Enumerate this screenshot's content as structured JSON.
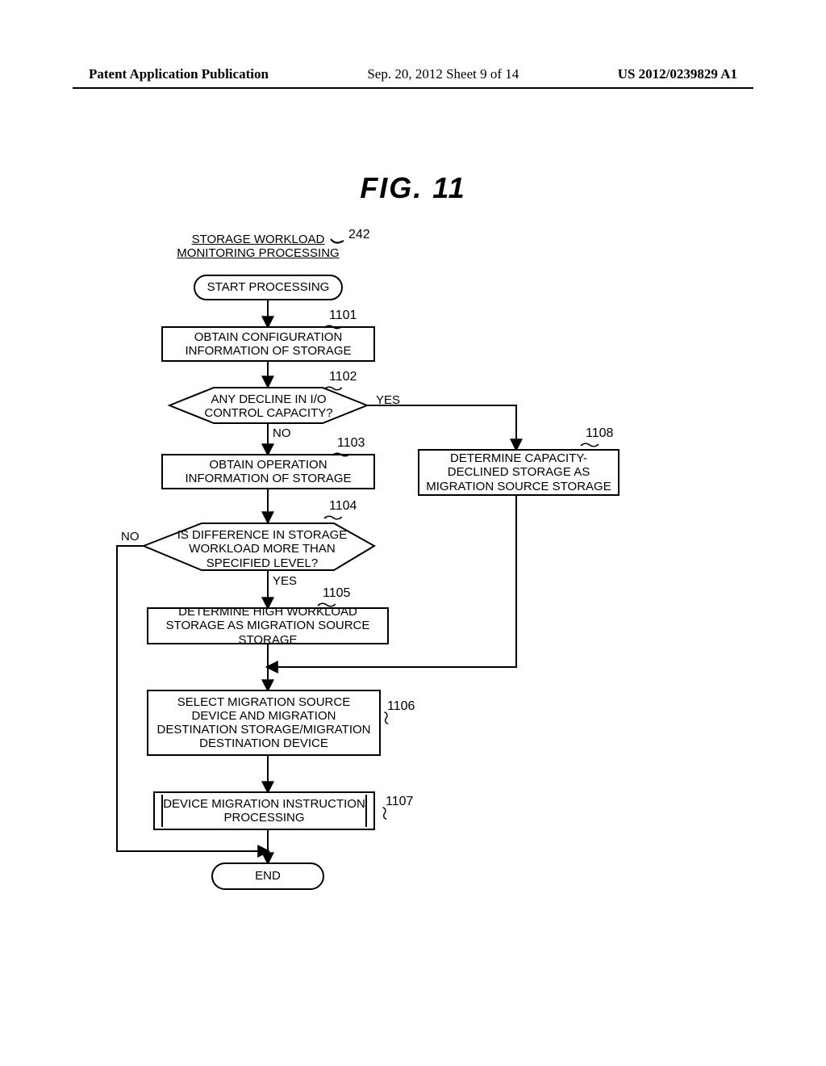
{
  "header": {
    "left": "Patent Application Publication",
    "center": "Sep. 20, 2012  Sheet 9 of 14",
    "right": "US 2012/0239829 A1"
  },
  "figure": {
    "title": "FIG.  11",
    "process_title": "STORAGE WORKLOAD MONITORING PROCESSING",
    "process_title_ref": "242",
    "start": "START PROCESSING",
    "end": "END",
    "steps": {
      "s1101": {
        "text": "OBTAIN CONFIGURATION INFORMATION OF STORAGE",
        "ref": "1101"
      },
      "s1102": {
        "text": "ANY DECLINE IN I/O CONTROL CAPACITY?",
        "ref": "1102",
        "yes": "YES",
        "no": "NO"
      },
      "s1103": {
        "text": "OBTAIN OPERATION INFORMATION OF STORAGE",
        "ref": "1103"
      },
      "s1104": {
        "text": "IS DIFFERENCE IN STORAGE WORKLOAD MORE THAN SPECIFIED LEVEL?",
        "ref": "1104",
        "yes": "YES",
        "no": "NO"
      },
      "s1105": {
        "text": "DETERMINE HIGH WORKLOAD STORAGE AS MIGRATION SOURCE STORAGE",
        "ref": "1105"
      },
      "s1106": {
        "text": "SELECT MIGRATION SOURCE DEVICE AND MIGRATION DESTINATION STORAGE/MIGRATION DESTINATION DEVICE",
        "ref": "1106"
      },
      "s1107": {
        "text": "DEVICE MIGRATION INSTRUCTION PROCESSING",
        "ref": "1107"
      },
      "s1108": {
        "text": "DETERMINE CAPACITY-DECLINED STORAGE AS MIGRATION SOURCE STORAGE",
        "ref": "1108"
      }
    }
  }
}
